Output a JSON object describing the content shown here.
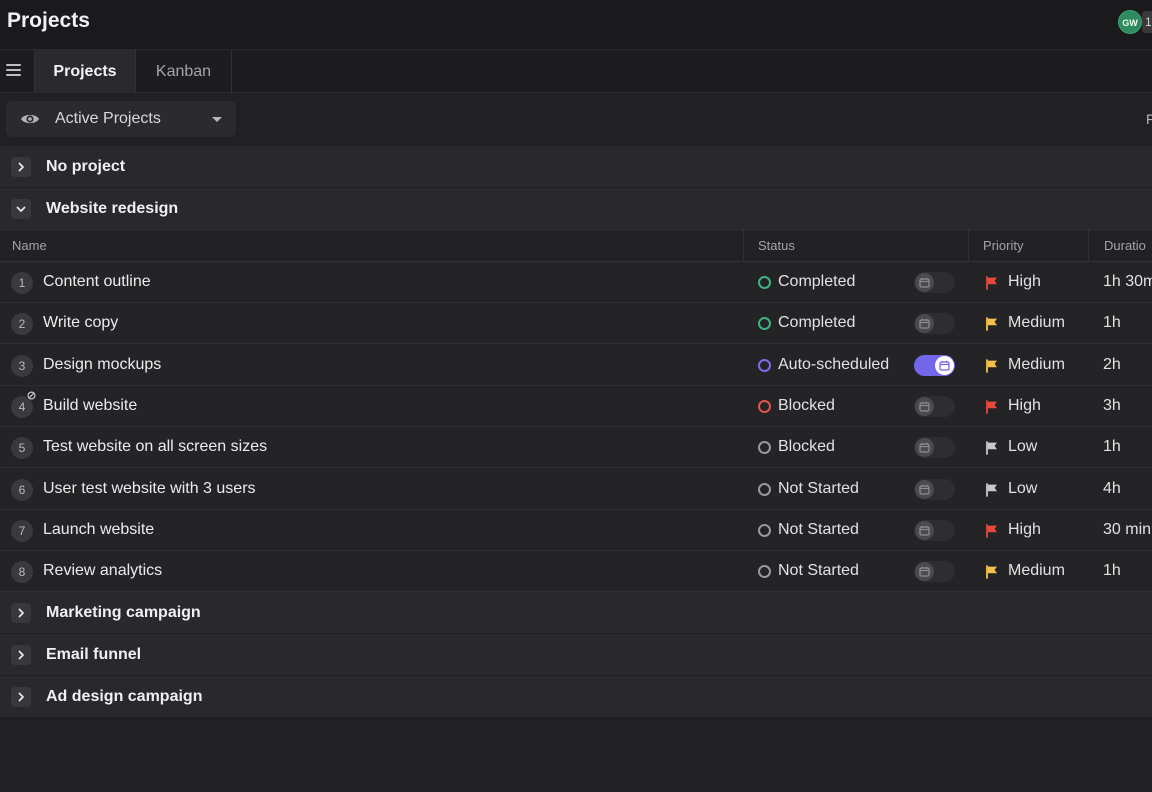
{
  "header": {
    "title": "Projects",
    "avatar_initials": "GW",
    "avatar_count": "1"
  },
  "tabs": [
    {
      "label": "Projects"
    },
    {
      "label": "Kanban"
    }
  ],
  "filter": {
    "view_label": "Active Projects",
    "edge_label": "F"
  },
  "groups": {
    "no_project": "No project",
    "website_redesign": "Website redesign",
    "marketing_campaign": "Marketing campaign",
    "email_funnel": "Email funnel",
    "ad_design_campaign": "Ad design campaign"
  },
  "columns": {
    "name": "Name",
    "status": "Status",
    "priority": "Priority",
    "duration": "Duratio"
  },
  "colors": {
    "completed": "#3fb37f",
    "auto_scheduled": "#7b6cf0",
    "blocked_red": "#e5534b",
    "neutral": "#9a9a9e",
    "flag_high": "#e5483d",
    "flag_medium": "#f3c04a",
    "flag_low": "#c8c8cc"
  },
  "tasks": [
    {
      "num": "1",
      "name": "Content outline",
      "status": "Completed",
      "status_color": "#3fb37f",
      "toggle_on": false,
      "priority": "High",
      "flag_color": "#e5483d",
      "duration": "1h 30m"
    },
    {
      "num": "2",
      "name": "Write copy",
      "status": "Completed",
      "status_color": "#3fb37f",
      "toggle_on": false,
      "priority": "Medium",
      "flag_color": "#f3c04a",
      "duration": "1h"
    },
    {
      "num": "3",
      "name": "Design mockups",
      "status": "Auto-scheduled",
      "status_color": "#7b6cf0",
      "toggle_on": true,
      "priority": "Medium",
      "flag_color": "#f3c04a",
      "duration": "2h"
    },
    {
      "num": "4",
      "name": "Build website",
      "status": "Blocked",
      "status_color": "#e5534b",
      "toggle_on": false,
      "priority": "High",
      "flag_color": "#e5483d",
      "duration": "3h"
    },
    {
      "num": "5",
      "name": "Test website on all screen sizes",
      "status": "Blocked",
      "status_color": "#9a9a9e",
      "toggle_on": false,
      "priority": "Low",
      "flag_color": "#c8c8cc",
      "duration": "1h"
    },
    {
      "num": "6",
      "name": "User test website with 3 users",
      "status": "Not Started",
      "status_color": "#9a9a9e",
      "toggle_on": false,
      "priority": "Low",
      "flag_color": "#c8c8cc",
      "duration": "4h"
    },
    {
      "num": "7",
      "name": "Launch website",
      "status": "Not Started",
      "status_color": "#9a9a9e",
      "toggle_on": false,
      "priority": "High",
      "flag_color": "#e5483d",
      "duration": "30 min"
    },
    {
      "num": "8",
      "name": "Review analytics",
      "status": "Not Started",
      "status_color": "#9a9a9e",
      "toggle_on": false,
      "priority": "Medium",
      "flag_color": "#f3c04a",
      "duration": "1h"
    }
  ]
}
